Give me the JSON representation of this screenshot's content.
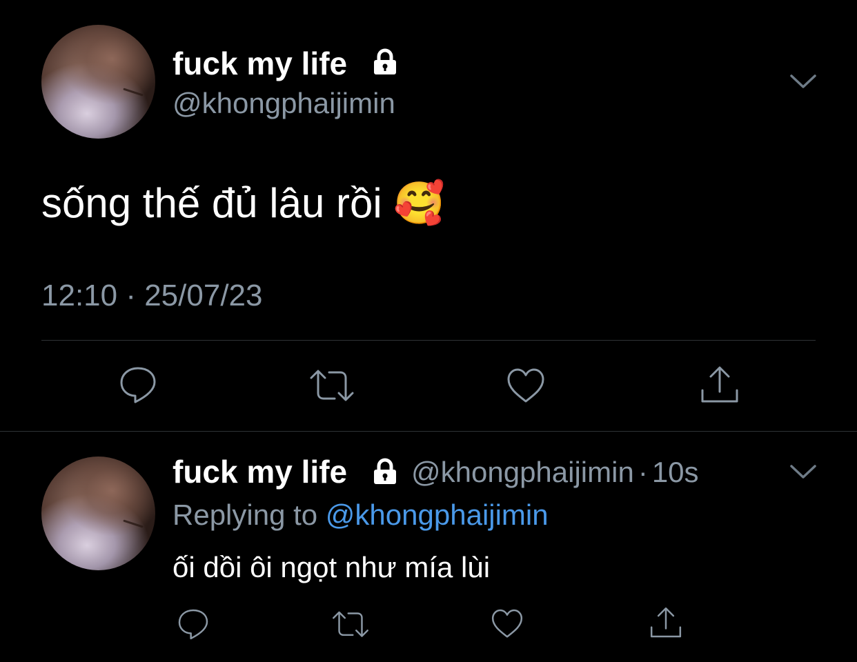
{
  "main_tweet": {
    "display_name": "fuck my life",
    "handle": "@khongphaijimin",
    "text": "sống thế đủ lâu rồi",
    "emoji": "🥰",
    "timestamp": "12:10 · 25/07/23",
    "icons": {
      "lock": "lock-icon",
      "more": "chevron-down-icon",
      "reply": "reply-icon",
      "retweet": "retweet-icon",
      "like": "heart-icon",
      "share": "share-icon"
    }
  },
  "reply_tweet": {
    "display_name": "fuck my life",
    "handle": "@khongphaijimin",
    "separator": "·",
    "time": "10s",
    "replying_prefix": "Replying to",
    "replying_to": "@khongphaijimin",
    "text": "ối dồi ôi ngọt như mía lùi"
  },
  "colors": {
    "background": "#000000",
    "text": "#ffffff",
    "muted": "#8b98a5",
    "link": "#4a99e9",
    "divider": "#2f3336"
  }
}
